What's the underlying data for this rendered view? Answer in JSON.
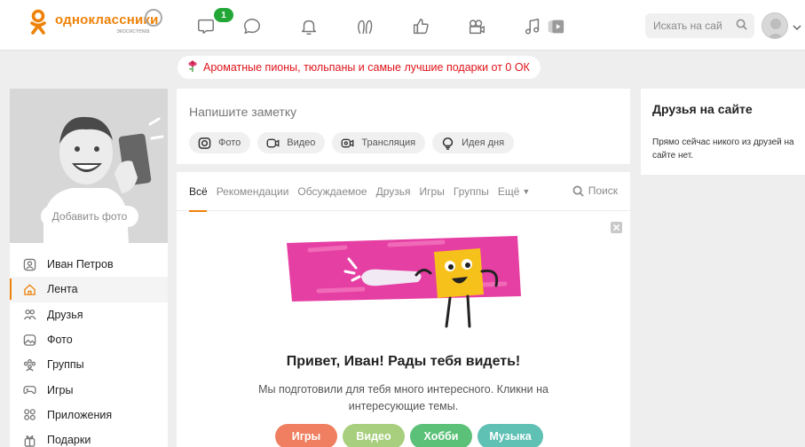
{
  "header": {
    "logo_name": "одноклассники",
    "logo_sub": "экосистема",
    "notification_badge": "1",
    "search_placeholder": "Искать на сай",
    "nav_icons": [
      "messages-icon",
      "discussions-icon",
      "notifications-icon",
      "guests-icon",
      "likes-icon",
      "video-icon",
      "music-icon",
      "games-promo-icon"
    ]
  },
  "banner": {
    "text": "Ароматные пионы, тюльпаны и самые лучшие подарки от 0 ОК"
  },
  "profile": {
    "add_photo_label": "Добавить фото"
  },
  "sidebar": {
    "items": [
      {
        "label": "Иван Петров",
        "icon": "user-icon"
      },
      {
        "label": "Лента",
        "icon": "home-icon"
      },
      {
        "label": "Друзья",
        "icon": "friends-icon"
      },
      {
        "label": "Фото",
        "icon": "photo-icon"
      },
      {
        "label": "Группы",
        "icon": "groups-icon"
      },
      {
        "label": "Игры",
        "icon": "gamepad-icon"
      },
      {
        "label": "Приложения",
        "icon": "apps-icon"
      },
      {
        "label": "Подарки",
        "icon": "gift-icon"
      }
    ],
    "active_index": 1
  },
  "post_box": {
    "placeholder": "Напишите заметку",
    "actions": [
      "Фото",
      "Видео",
      "Трансляция",
      "Идея дня"
    ]
  },
  "feed": {
    "tabs": [
      "Всё",
      "Рекомендации",
      "Обсуждаемое",
      "Друзья",
      "Игры",
      "Группы",
      "Ещё"
    ],
    "active_tab": 0,
    "search_label": "Поиск",
    "greeting": "Привет, Иван! Рады тебя видеть!",
    "subtext": "Мы подготовили для тебя много интересного. Кликни на интересующие темы.",
    "topics": [
      {
        "label": "Игры",
        "color": "#ef7f60"
      },
      {
        "label": "Видео",
        "color": "#a7cf7e"
      },
      {
        "label": "Хобби",
        "color": "#5bc078"
      },
      {
        "label": "Музыка",
        "color": "#5fc0b4"
      }
    ]
  },
  "friends": {
    "title": "Друзья на сайте",
    "text": "Прямо сейчас никого из друзей на сайте нет."
  },
  "colors": {
    "brand": "#ee8208",
    "banner_text": "#e0131a",
    "illustration_pink": "#e63fa3",
    "illustration_yellow": "#f7c11b"
  }
}
